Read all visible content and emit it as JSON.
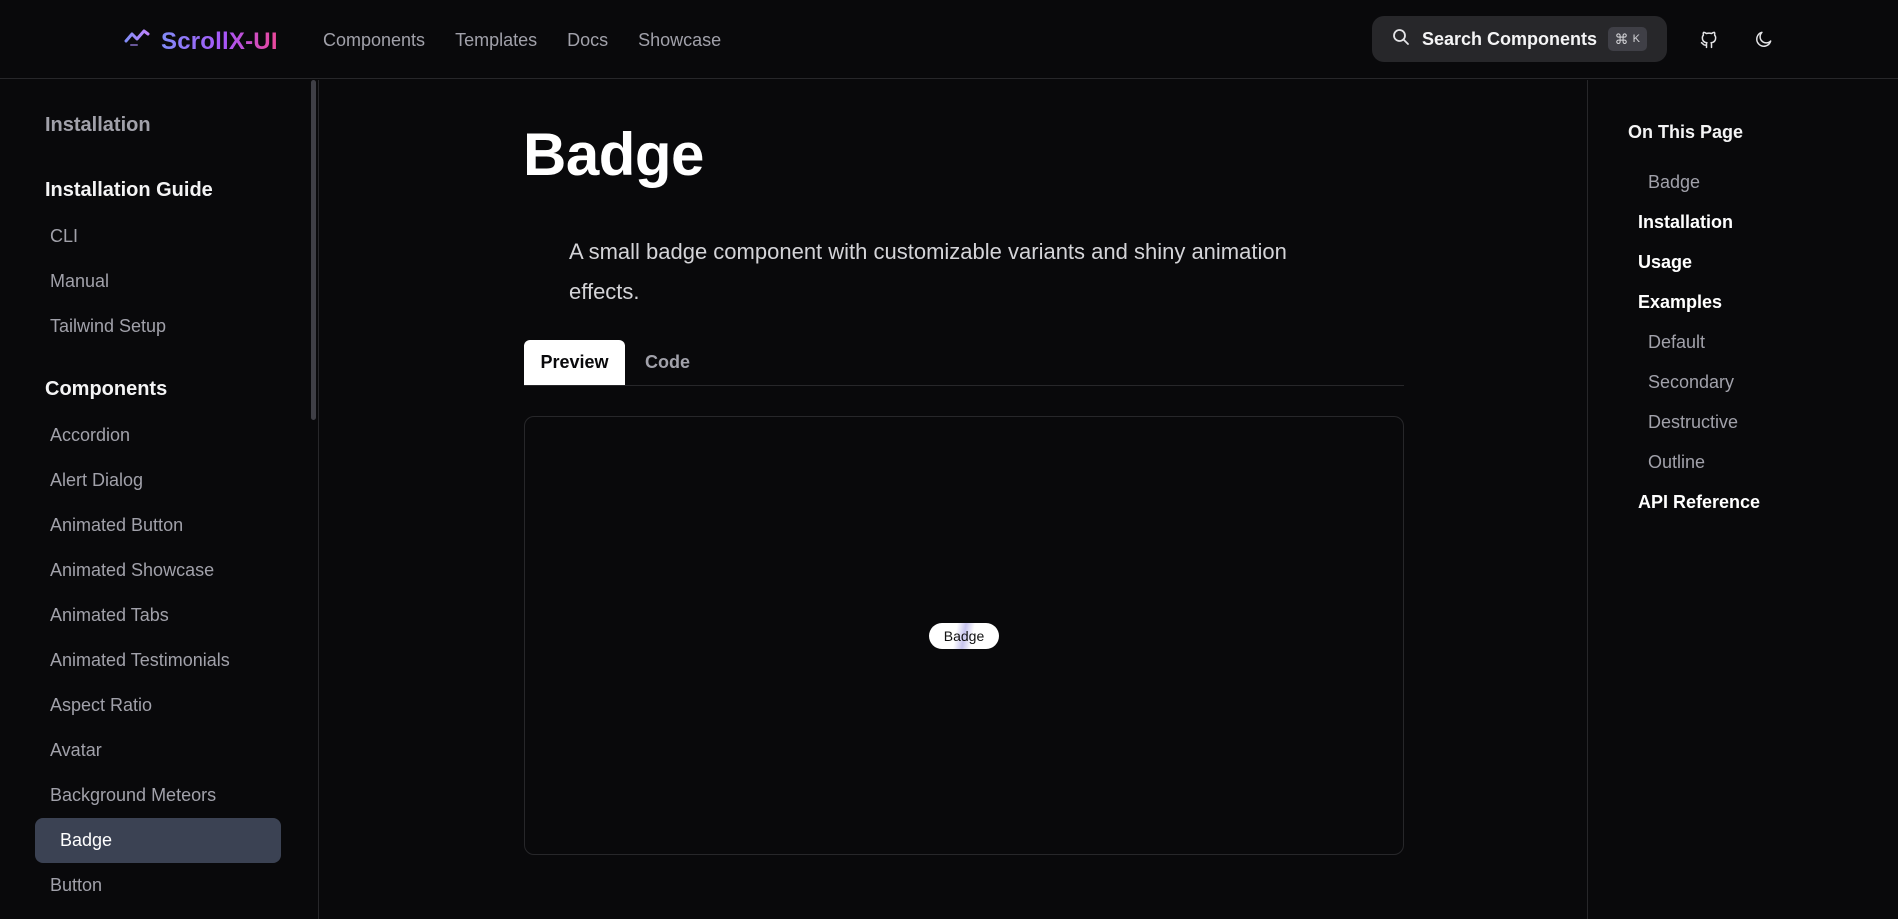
{
  "header": {
    "logo": "ScrollX-UI",
    "nav": [
      "Components",
      "Templates",
      "Docs",
      "Showcase"
    ],
    "search_label": "Search Components",
    "shortcut_symbol": "⌘",
    "shortcut_key": "K"
  },
  "sidebar": {
    "installation": "Installation",
    "installation_guide": "Installation Guide",
    "guide_items": [
      "CLI",
      "Manual",
      "Tailwind Setup"
    ],
    "components_heading": "Components",
    "component_items": [
      "Accordion",
      "Alert Dialog",
      "Animated Button",
      "Animated Showcase",
      "Animated Tabs",
      "Animated Testimonials",
      "Aspect Ratio",
      "Avatar",
      "Background Meteors",
      "Badge",
      "Button"
    ],
    "active_item": "Badge"
  },
  "main": {
    "title": "Badge",
    "description": "A small badge component with customizable variants and shiny animation effects.",
    "tabs": [
      "Preview",
      "Code"
    ],
    "badge_label": "Badge"
  },
  "toc": {
    "title": "On This Page",
    "items": [
      {
        "label": "Badge",
        "level": 2
      },
      {
        "label": "Installation",
        "level": 1
      },
      {
        "label": "Usage",
        "level": 1
      },
      {
        "label": "Examples",
        "level": 1
      },
      {
        "label": "Default",
        "level": 2
      },
      {
        "label": "Secondary",
        "level": 2
      },
      {
        "label": "Destructive",
        "level": 2
      },
      {
        "label": "Outline",
        "level": 2
      },
      {
        "label": "API Reference",
        "level": 1
      }
    ]
  },
  "colors": {
    "background": "#09090b",
    "logo_gradient": [
      "#818cf8",
      "#a855f7",
      "#ec4899"
    ],
    "active_sidebar": "#3b4253"
  }
}
